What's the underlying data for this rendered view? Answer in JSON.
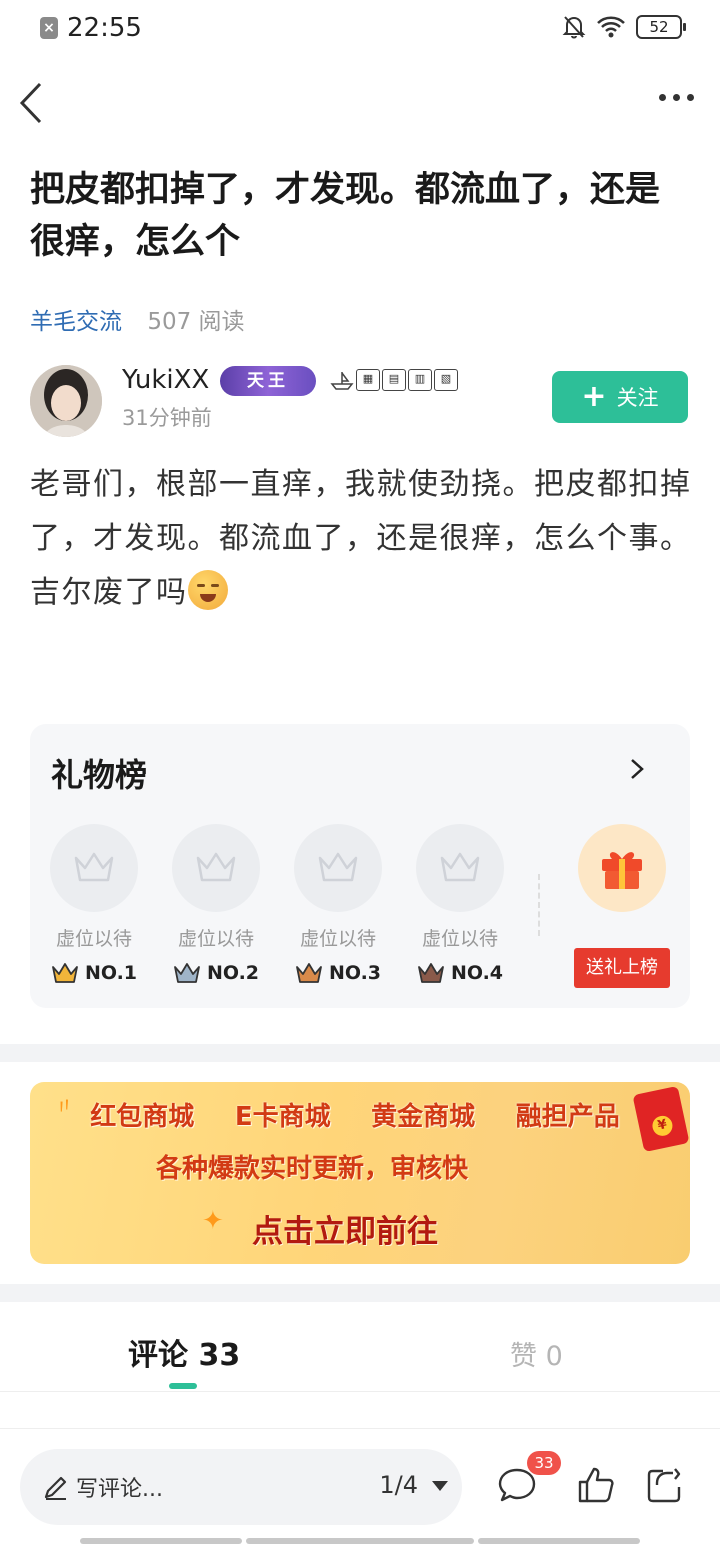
{
  "status_bar": {
    "time": "22:55",
    "battery": "52"
  },
  "post": {
    "title": "把皮都扣掉了，才发现。都流血了，还是很痒，怎么个",
    "category": "羊毛交流",
    "reads": "507 阅读",
    "author": {
      "name": "YukiXX",
      "badge": "天王",
      "time": "31分钟前"
    },
    "follow_label": "关注",
    "body": "老哥们，根部一直痒，我就使劲挠。把皮都扣掉了，才发现。都流血了，还是很痒，怎么个事。吉尔废了吗"
  },
  "gift_board": {
    "title": "礼物榜",
    "slots": [
      {
        "status": "虚位以待",
        "rank": "NO.1",
        "color": "#f2b53a"
      },
      {
        "status": "虚位以待",
        "rank": "NO.2",
        "color": "#9fb4c8"
      },
      {
        "status": "虚位以待",
        "rank": "NO.3",
        "color": "#d98a4a"
      },
      {
        "status": "虚位以待",
        "rank": "NO.4",
        "color": "#8a5a4a"
      }
    ],
    "send_label": "送礼上榜"
  },
  "banner": {
    "items": [
      "红包商城",
      "E卡商城",
      "黄金商城",
      "融担产品"
    ],
    "subtitle": "各种爆款实时更新，审核快",
    "cta": "点击立即前往"
  },
  "tabs": {
    "comments": "评论 33",
    "likes": "赞 0"
  },
  "bottom_bar": {
    "placeholder": "写评论...",
    "pager": "1/4",
    "comment_count": "33"
  },
  "colors": {
    "accent": "#2dbf98",
    "link": "#2f6cb3",
    "danger": "#e63b2e"
  }
}
